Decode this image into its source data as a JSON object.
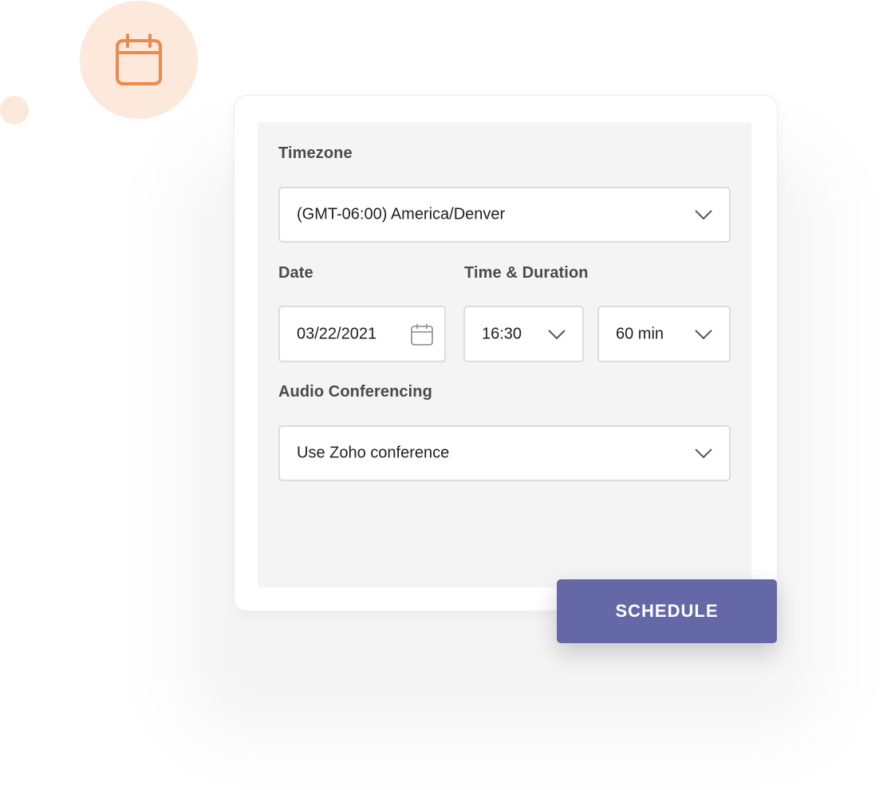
{
  "form": {
    "timezone_label": "Timezone",
    "timezone_value": "(GMT-06:00) America/Denver",
    "date_label": "Date",
    "date_value": "03/22/2021",
    "time_duration_label": "Time & Duration",
    "time_value": "16:30",
    "duration_value": "60 min",
    "audio_label": "Audio Conferencing",
    "audio_value": "Use Zoho conference"
  },
  "actions": {
    "schedule_label": "SCHEDULE"
  },
  "icons": {
    "badge_icon": "calendar-icon",
    "date_icon": "calendar-icon",
    "dropdown_icon": "chevron-down-icon"
  },
  "colors": {
    "accent": "#6468a6",
    "badge_bg": "#fde8dc",
    "badge_icon": "#ec8a4d"
  }
}
